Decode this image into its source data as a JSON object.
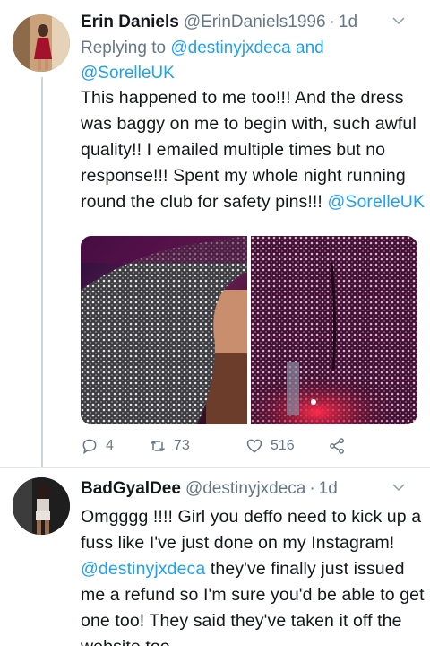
{
  "tweets": [
    {
      "display_name": "Erin Daniels",
      "handle": "@ErinDaniels1996",
      "separator": "·",
      "time": "1d",
      "replying_to": {
        "prefix": "Replying to",
        "mention_1": "@destinyjxdeca",
        "joiner": "and",
        "mention_2": "@SorelleUK"
      },
      "text": "This happened to me too!!! And the dress was baggy on me to begin with, such awful quality!! I emailed multiple times but no response!!! Spent my whole night running round the club for safety pins!!!",
      "text_mention": "@SorelleUK",
      "actions": {
        "replies": "4",
        "retweets": "73",
        "likes": "516"
      },
      "photos": [
        "sparkly-dress-photo-1",
        "sparkly-dress-photo-2"
      ]
    },
    {
      "display_name": "BadGyalDee",
      "handle": "@destinyjxdeca",
      "separator": "·",
      "time": "1d",
      "text_before": "Omgggg !!!! Girl you deffo need to kick up a fuss like I've just done on my Instagram!",
      "text_mention": "@destinyjxdeca",
      "text_after": "they've finally just issued me a refund so I'm sure you'd be able to get one too! They said they've taken it off the website too"
    }
  ],
  "colors": {
    "link": "#1da1f2",
    "secondary": "#657786",
    "text": "#14171a",
    "thread_line": "#ccd6dd"
  },
  "icons": [
    "reply-icon",
    "retweet-icon",
    "like-icon",
    "share-icon",
    "chevron-down-icon"
  ]
}
